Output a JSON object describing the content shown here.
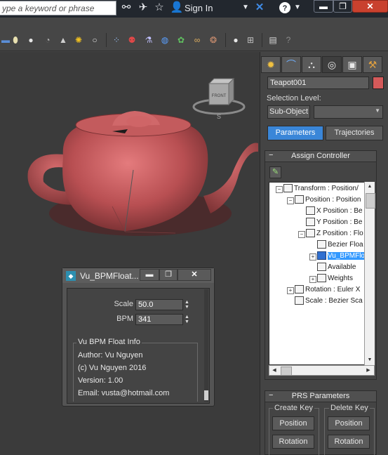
{
  "search": {
    "placeholder": "ype a keyword or phrase"
  },
  "header": {
    "signin_label": "Sign In"
  },
  "colors": {
    "accent": "#3a86d8",
    "object_swatch": "#d45a5a",
    "teapot": "#b84f52"
  },
  "viewcube": {
    "face_label": "FRONT",
    "compass_s": "S"
  },
  "command_panel": {
    "object_name": "Teapot001",
    "selection_level_label": "Selection Level:",
    "subobject_label": "Sub-Object",
    "subobject_value": "",
    "tab_parameters": "Parameters",
    "tab_trajectories": "Trajectories",
    "assign_controller_title": "Assign Controller",
    "tree": [
      {
        "label": "Transform : Position/",
        "indent": 0,
        "expander": "−",
        "selected": false
      },
      {
        "label": "Position : Position",
        "indent": 1,
        "expander": "−",
        "selected": false
      },
      {
        "label": "X Position : Be",
        "indent": 2,
        "expander": "",
        "selected": false
      },
      {
        "label": "Y Position : Be",
        "indent": 2,
        "expander": "",
        "selected": false
      },
      {
        "label": "Z Position : Flo",
        "indent": 2,
        "expander": "−",
        "selected": false
      },
      {
        "label": "Bezier Floa",
        "indent": 3,
        "expander": "",
        "selected": false
      },
      {
        "label": "Vu_BPMFlo",
        "indent": 3,
        "expander": "+",
        "selected": true
      },
      {
        "label": "Available",
        "indent": 3,
        "expander": "",
        "selected": false
      },
      {
        "label": "Weights",
        "indent": 3,
        "expander": "+",
        "selected": false
      },
      {
        "label": "Rotation : Euler X",
        "indent": 1,
        "expander": "+",
        "selected": false
      },
      {
        "label": "Scale : Bezier Sca",
        "indent": 1,
        "expander": "",
        "selected": false
      }
    ],
    "prs_title": "PRS Parameters",
    "create_key_label": "Create Key",
    "delete_key_label": "Delete Key",
    "create_position": "Position",
    "create_rotation": "Rotation",
    "delete_position": "Position",
    "delete_rotation": "Rotation"
  },
  "floater": {
    "title": "Vu_BPMFloat...",
    "scale_label": "Scale",
    "scale_value": "50.0",
    "bpm_label": "BPM",
    "bpm_value": "341",
    "info_group_title": "Vu BPM Float Info",
    "author": "Author: Vu Nguyen",
    "copyright": "(c) Vu Nguyen 2016",
    "version": "Version: 1.00",
    "email": "Email: vusta@hotmail.com"
  }
}
